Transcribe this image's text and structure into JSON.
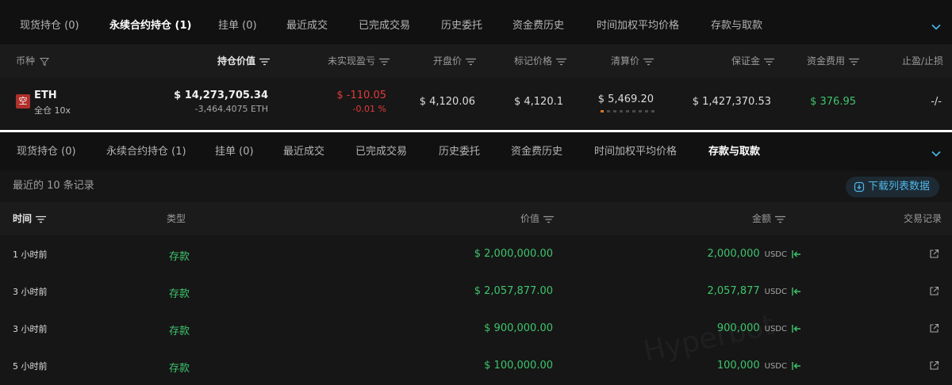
{
  "top_panel": {
    "tabs": [
      {
        "label": "现货持仓 (0)"
      },
      {
        "label": "永续合约持仓 (1)"
      },
      {
        "label": "挂单 (0)"
      },
      {
        "label": "最近成交"
      },
      {
        "label": "已完成交易"
      },
      {
        "label": "历史委托"
      },
      {
        "label": "资金费历史"
      },
      {
        "label": "时间加权平均价格"
      },
      {
        "label": "存款与取款"
      }
    ],
    "active_tab": 1,
    "columns": {
      "coin": "币种",
      "position_value": "持仓价值",
      "unrealized_pnl": "未实现盈亏",
      "entry_price": "开盘价",
      "mark_price": "标记价格",
      "liq_price": "清算价",
      "margin": "保证金",
      "funding": "资金费用",
      "tp_sl": "止盈/止损"
    },
    "position": {
      "side_badge": "空",
      "symbol": "ETH",
      "mode": "全仓 10x",
      "position_value": "$ 14,273,705.34",
      "size": "-3,464.4075 ETH",
      "pnl": "$ -110.05",
      "pnl_pct": "-0.01 %",
      "entry_price": "$ 4,120.06",
      "mark_price": "$ 4,120.1",
      "liq_price": "$ 5,469.20",
      "liq_risk_level": 1,
      "liq_risk_segments": 9,
      "margin": "$ 1,427,370.53",
      "funding": "$ 376.95",
      "tp_sl": "-/-"
    }
  },
  "bottom_panel": {
    "tabs": [
      {
        "label": "现货持仓 (0)"
      },
      {
        "label": "永续合约持仓 (1)"
      },
      {
        "label": "挂单 (0)"
      },
      {
        "label": "最近成交"
      },
      {
        "label": "已完成交易"
      },
      {
        "label": "历史委托"
      },
      {
        "label": "资金费历史"
      },
      {
        "label": "时间加权平均价格"
      },
      {
        "label": "存款与取款"
      }
    ],
    "active_tab": 8,
    "record_count_text": "最近的 10 条记录",
    "download_label": "下载列表数据",
    "columns": {
      "time": "时间",
      "type": "类型",
      "value": "价值",
      "amount": "金额",
      "tx": "交易记录"
    },
    "rows": [
      {
        "time": "1 小时前",
        "type": "存款",
        "value": "$ 2,000,000.00",
        "amount": "2,000,000",
        "unit": "USDC"
      },
      {
        "time": "3 小时前",
        "type": "存款",
        "value": "$ 2,057,877.00",
        "amount": "2,057,877",
        "unit": "USDC"
      },
      {
        "time": "3 小时前",
        "type": "存款",
        "value": "$ 900,000.00",
        "amount": "900,000",
        "unit": "USDC"
      },
      {
        "time": "5 小时前",
        "type": "存款",
        "value": "$ 100,000.00",
        "amount": "100,000",
        "unit": "USDC"
      }
    ],
    "watermark": "Hyperbot"
  },
  "colors": {
    "positive": "#3ec46d",
    "negative": "#e23b3b",
    "accent": "#4fb8ea",
    "short_badge": "#b0302c"
  }
}
